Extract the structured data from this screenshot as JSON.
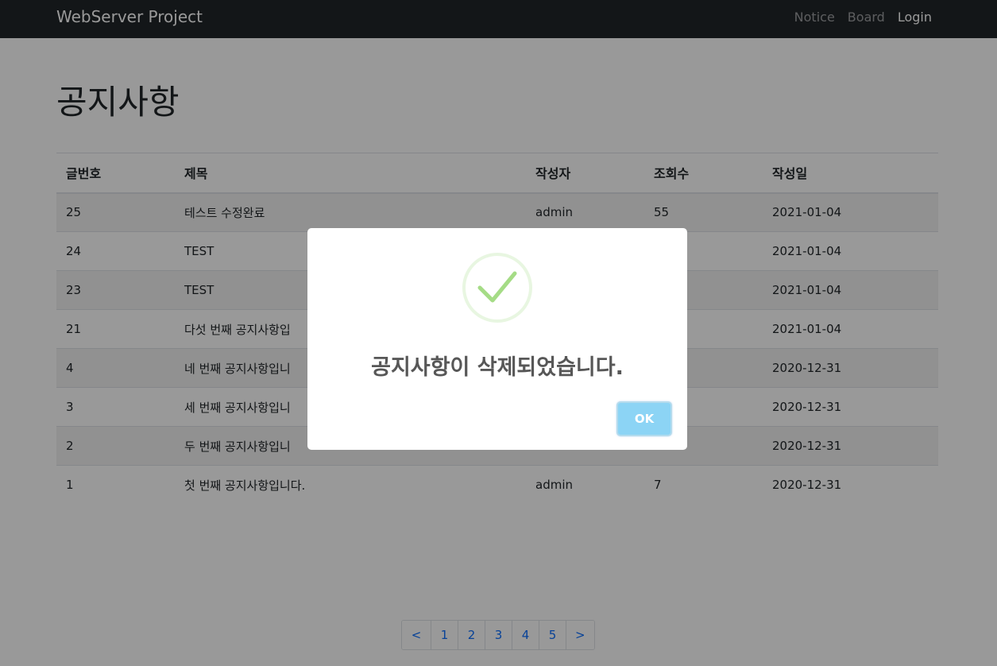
{
  "navbar": {
    "brand": "WebServer Project",
    "links": [
      {
        "label": "Notice",
        "active": false
      },
      {
        "label": "Board",
        "active": false
      },
      {
        "label": "Login",
        "active": true
      }
    ]
  },
  "page": {
    "title": "공지사항"
  },
  "table": {
    "headers": [
      "글번호",
      "제목",
      "작성자",
      "조회수",
      "작성일"
    ],
    "rows": [
      [
        "25",
        "테스트 수정완료",
        "admin",
        "55",
        "2021-01-04"
      ],
      [
        "24",
        "TEST",
        "",
        "",
        "2021-01-04"
      ],
      [
        "23",
        "TEST",
        "",
        "",
        "2021-01-04"
      ],
      [
        "21",
        "다섯 번째 공지사항입",
        "",
        "",
        "2021-01-04"
      ],
      [
        "4",
        "네 번째 공지사항입니",
        "",
        "",
        "2020-12-31"
      ],
      [
        "3",
        "세 번째 공지사항입니",
        "",
        "",
        "2020-12-31"
      ],
      [
        "2",
        "두 번째 공지사항입니",
        "",
        "",
        "2020-12-31"
      ],
      [
        "1",
        "첫 번째 공지사항입니다.",
        "admin",
        "7",
        "2020-12-31"
      ]
    ]
  },
  "pagination": {
    "prev": "<",
    "pages": [
      "1",
      "2",
      "3",
      "4",
      "5"
    ],
    "next": ">"
  },
  "modal": {
    "icon": "checkmark-icon",
    "message": "공지사항이 삭제되었습니다.",
    "ok_label": "OK"
  },
  "colors": {
    "navbar": "#212529",
    "link": "#0d6efd",
    "success": "#a5dc86",
    "ok_button": "#8cd4f5"
  }
}
